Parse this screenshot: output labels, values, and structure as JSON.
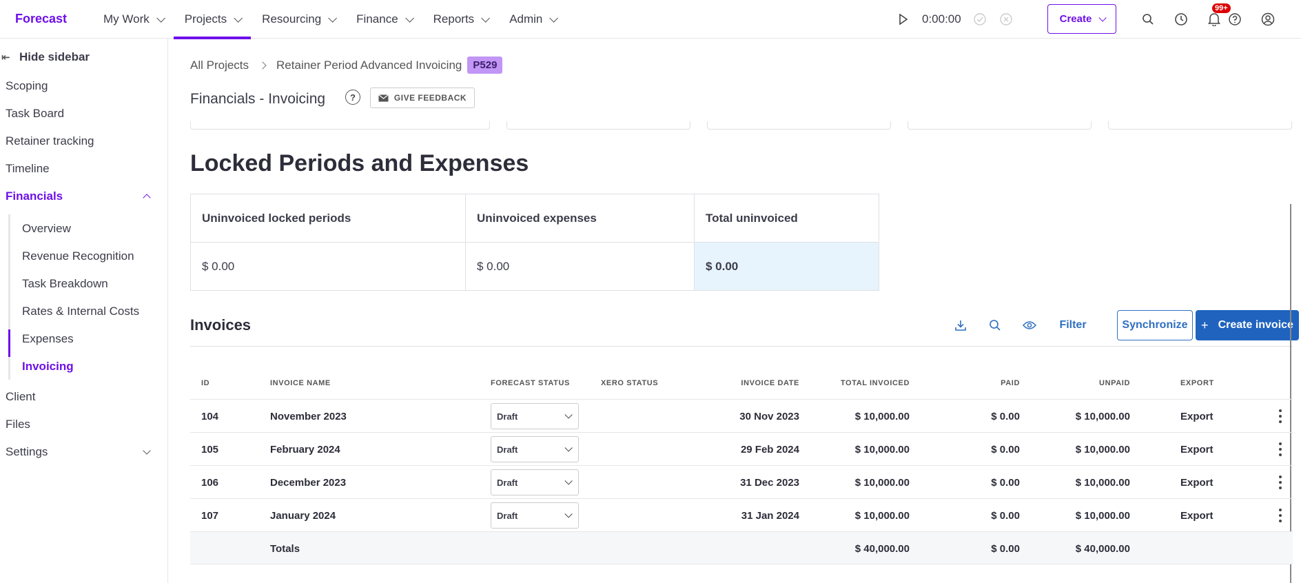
{
  "app": {
    "logo": "Forecast"
  },
  "nav": {
    "items": [
      {
        "label": "My Work"
      },
      {
        "label": "Projects"
      },
      {
        "label": "Resourcing"
      },
      {
        "label": "Finance"
      },
      {
        "label": "Reports"
      },
      {
        "label": "Admin"
      }
    ],
    "active": "Projects"
  },
  "timer": {
    "value": "0:00:00"
  },
  "header": {
    "create_label": "Create",
    "notification_count": "99+"
  },
  "sidebar": {
    "hide_label": "Hide sidebar",
    "items": {
      "scoping": "Scoping",
      "task_board": "Task Board",
      "retainer": "Retainer tracking",
      "timeline": "Timeline",
      "financials": "Financials",
      "client": "Client",
      "files": "Files",
      "settings": "Settings"
    },
    "financials_sub": {
      "overview": "Overview",
      "revenue": "Revenue Recognition",
      "task_breakdown": "Task Breakdown",
      "rates": "Rates & Internal Costs",
      "expenses": "Expenses",
      "invoicing": "Invoicing"
    }
  },
  "breadcrumb": {
    "root": "All Projects",
    "project": "Retainer Period Advanced Invoicing",
    "project_id": "P529"
  },
  "page": {
    "title": "Financials - Invoicing",
    "help": "?",
    "feedback": "GIVE FEEDBACK"
  },
  "locked": {
    "title": "Locked Periods and Expenses",
    "headers": {
      "periods": "Uninvoiced locked periods",
      "expenses": "Uninvoiced expenses",
      "total": "Total uninvoiced"
    },
    "values": {
      "periods": "$ 0.00",
      "expenses": "$ 0.00",
      "total": "$ 0.00"
    }
  },
  "invoices": {
    "title": "Invoices",
    "filter": "Filter",
    "synchronize": "Synchronize",
    "create": "Create invoice",
    "columns": {
      "id": "ID",
      "name": "INVOICE NAME",
      "forecast_status": "FORECAST STATUS",
      "xero_status": "XERO STATUS",
      "date": "INVOICE DATE",
      "total": "TOTAL INVOICED",
      "paid": "PAID",
      "unpaid": "UNPAID",
      "export": "EXPORT"
    },
    "rows": [
      {
        "id": "104",
        "name": "November 2023",
        "status": "Draft",
        "date": "30 Nov 2023",
        "total": "$ 10,000.00",
        "paid": "$ 0.00",
        "unpaid": "$ 10,000.00",
        "export": "Export"
      },
      {
        "id": "105",
        "name": "February 2024",
        "status": "Draft",
        "date": "29 Feb 2024",
        "total": "$ 10,000.00",
        "paid": "$ 0.00",
        "unpaid": "$ 10,000.00",
        "export": "Export"
      },
      {
        "id": "106",
        "name": "December 2023",
        "status": "Draft",
        "date": "31 Dec 2023",
        "total": "$ 10,000.00",
        "paid": "$ 0.00",
        "unpaid": "$ 10,000.00",
        "export": "Export"
      },
      {
        "id": "107",
        "name": "January 2024",
        "status": "Draft",
        "date": "31 Jan 2024",
        "total": "$ 10,000.00",
        "paid": "$ 0.00",
        "unpaid": "$ 10,000.00",
        "export": "Export"
      }
    ],
    "totals": {
      "label": "Totals",
      "total": "$ 40,000.00",
      "paid": "$ 0.00",
      "unpaid": "$ 40,000.00"
    }
  },
  "colors": {
    "brand": "#6e0fea",
    "action": "#1f63be",
    "highlight": "#e7f4fd"
  }
}
